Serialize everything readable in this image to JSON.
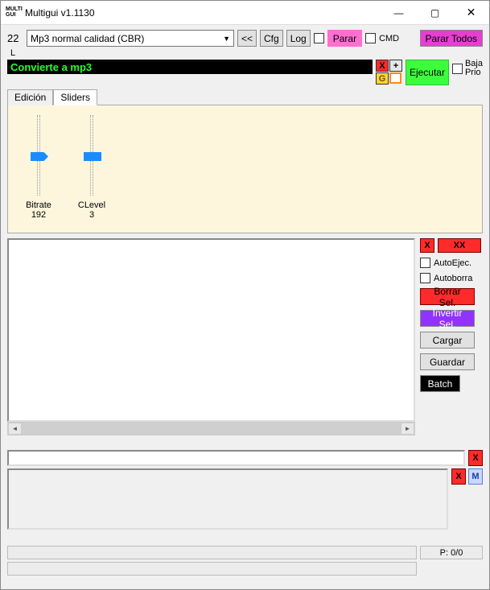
{
  "window": {
    "title": "Multigui v1.1130"
  },
  "toolbar": {
    "counter": "22",
    "dropdown_value": "Mp3 normal calidad (CBR)",
    "back": "<<",
    "cfg": "Cfg",
    "log": "Log",
    "parar": "Parar",
    "cmd": "CMD",
    "parar_todos": "Parar Todos",
    "letter_L": "L"
  },
  "main": {
    "banner": "Convierte a mp3",
    "ejecutar": "Ejecutar",
    "baja_prio_line1": "Baja",
    "baja_prio_line2": "Prio",
    "x": "X",
    "plus": "+",
    "g": "G"
  },
  "tabs": {
    "edicion": "Edición",
    "sliders": "Sliders"
  },
  "sliders": {
    "bitrate_label": "Bitrate",
    "bitrate_value": "192",
    "clevel_label": "CLevel",
    "clevel_value": "3"
  },
  "side": {
    "x": "X",
    "xx": "XX",
    "autoejec": "AutoEjec.",
    "autoborra": "Autoborra",
    "borrar_sel": "Borrar Sel.",
    "invertir_sel": "Invertir Sel.",
    "cargar": "Cargar",
    "guardar": "Guardar",
    "batch": "Batch"
  },
  "bottom": {
    "x": "X",
    "m": "M"
  },
  "status": {
    "p": "P: 0/0"
  }
}
